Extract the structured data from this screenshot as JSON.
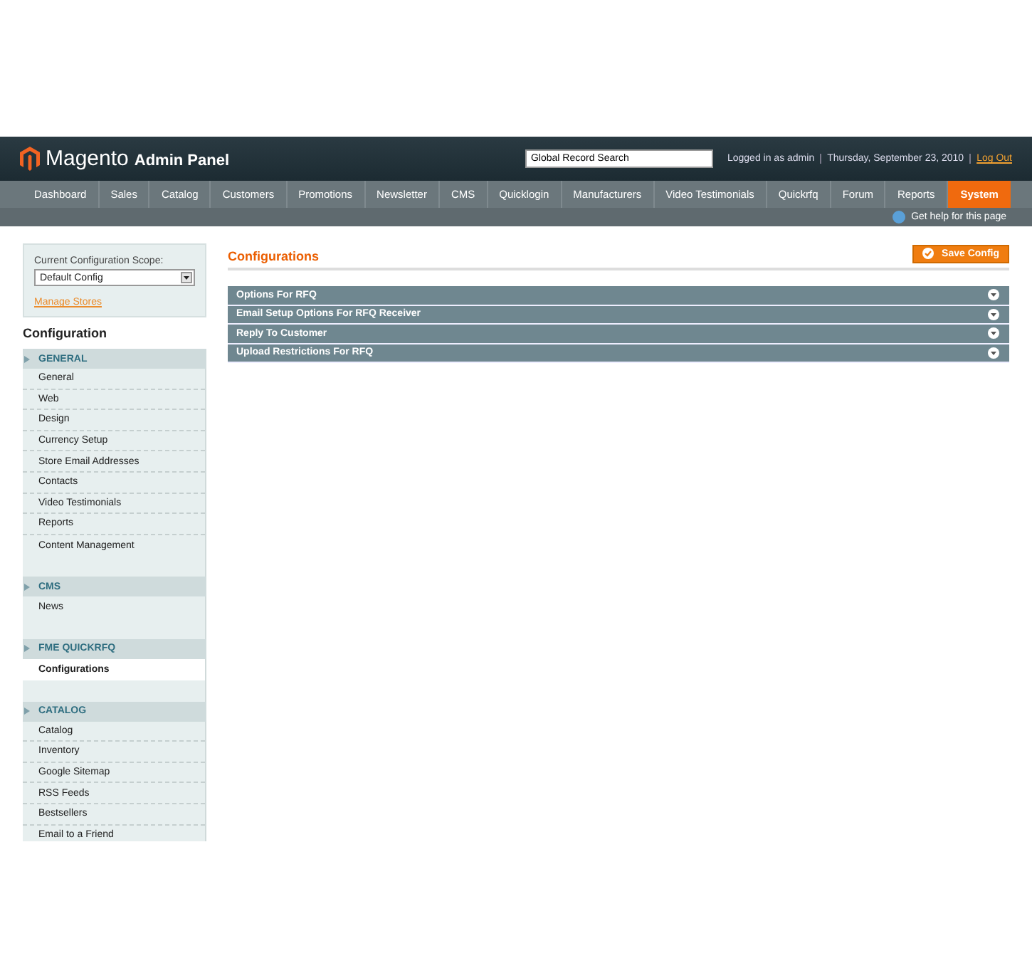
{
  "header": {
    "logo_text": "Magento",
    "logo_sub": "Admin Panel",
    "search": {
      "value": "Global Record Search"
    },
    "user_info": "Logged in as admin",
    "date": "Thursday, September 23, 2010",
    "logout": "Log Out"
  },
  "nav": [
    {
      "label": "Dashboard",
      "selected": false
    },
    {
      "label": "Sales",
      "selected": false
    },
    {
      "label": "Catalog",
      "selected": false
    },
    {
      "label": "Customers",
      "selected": false
    },
    {
      "label": "Promotions",
      "selected": false
    },
    {
      "label": "Newsletter",
      "selected": false
    },
    {
      "label": "CMS",
      "selected": false
    },
    {
      "label": "Quicklogin",
      "selected": false
    },
    {
      "label": "Manufacturers",
      "selected": false
    },
    {
      "label": "Video Testimonials",
      "selected": false
    },
    {
      "label": "Quickrfq",
      "selected": false
    },
    {
      "label": "Forum",
      "selected": false
    },
    {
      "label": "Reports",
      "selected": false
    },
    {
      "label": "System",
      "selected": true
    }
  ],
  "help_link": "Get help for this page",
  "sidebar": {
    "scope_label": "Current Configuration Scope:",
    "scope_value": "Default Config",
    "manage_stores": "Manage Stores",
    "title": "Configuration",
    "sections": [
      {
        "label": "GENERAL",
        "items": [
          {
            "label": "General",
            "selected": false
          },
          {
            "label": "Web",
            "selected": false
          },
          {
            "label": "Design",
            "selected": false
          },
          {
            "label": "Currency Setup",
            "selected": false
          },
          {
            "label": "Store Email Addresses",
            "selected": false
          },
          {
            "label": "Contacts",
            "selected": false
          },
          {
            "label": "Video Testimonials",
            "selected": false
          },
          {
            "label": "Reports",
            "selected": false
          },
          {
            "label": "Content Management",
            "selected": false
          }
        ]
      },
      {
        "label": "CMS",
        "items": [
          {
            "label": "News",
            "selected": false
          }
        ]
      },
      {
        "label": "FME QUICKRFQ",
        "items": [
          {
            "label": "Configurations",
            "selected": true
          }
        ]
      },
      {
        "label": "CATALOG",
        "items": [
          {
            "label": "Catalog",
            "selected": false
          },
          {
            "label": "Inventory",
            "selected": false
          },
          {
            "label": "Google Sitemap",
            "selected": false
          },
          {
            "label": "RSS Feeds",
            "selected": false
          },
          {
            "label": "Bestsellers",
            "selected": false
          },
          {
            "label": "Email to a Friend",
            "selected": false
          }
        ]
      }
    ]
  },
  "main": {
    "title": "Configurations",
    "save_button": "Save Config",
    "panels": [
      {
        "label": "Options For RFQ"
      },
      {
        "label": "Email Setup Options For RFQ Receiver"
      },
      {
        "label": "Reply To Customer"
      },
      {
        "label": "Upload Restrictions For RFQ"
      }
    ]
  }
}
